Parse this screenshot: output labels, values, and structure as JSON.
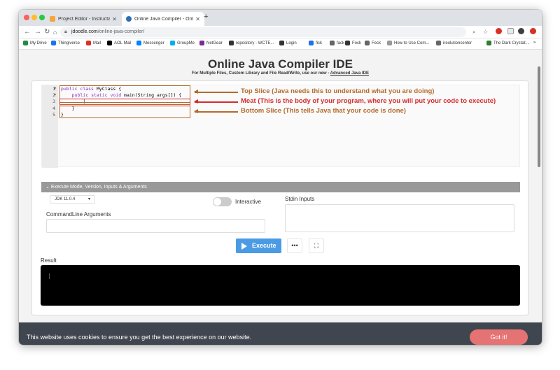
{
  "browser": {
    "tabs": [
      {
        "title": "Project Editor - Instructables"
      },
      {
        "title": "Online Java Compiler - Online"
      }
    ],
    "url_host": "jdoodle.com",
    "url_path": "/online-java-compiler/",
    "bookmarks": [
      {
        "label": "My Drive",
        "color": "#1e8e3e"
      },
      {
        "label": "Thingiverse",
        "color": "#1a73e8"
      },
      {
        "label": "Mail",
        "color": "#d93025"
      },
      {
        "label": "AOL Mail",
        "color": "#000000"
      },
      {
        "label": "Messenger",
        "color": "#0084ff"
      },
      {
        "label": "GroupMe",
        "color": "#00aff0"
      },
      {
        "label": "NetGear",
        "color": "#7b2c8f"
      },
      {
        "label": "repository - WCTE...",
        "color": "#333333"
      },
      {
        "label": "Login",
        "color": "#333333"
      },
      {
        "label": "fick",
        "color": "#1a73e8"
      },
      {
        "label": "fack",
        "color": "#666666"
      },
      {
        "label": "Fock",
        "color": "#333333"
      },
      {
        "label": "Feck",
        "color": "#666666"
      },
      {
        "label": "How to Use Com...",
        "color": "#999999"
      },
      {
        "label": "ireolutioncenter",
        "color": "#666666"
      },
      {
        "label": "The Dark Crystal:...",
        "color": "#2e7d32"
      }
    ]
  },
  "page": {
    "title": "Online Java Compiler IDE",
    "subtitle_prefix": "For Multiple Files, Custom Library and File Read/Write, use our new - ",
    "subtitle_link": "Advanced Java IDE"
  },
  "editor": {
    "lines": [
      {
        "num": "1",
        "fold": "▾",
        "code": "public class MyClass {"
      },
      {
        "num": "2",
        "fold": "▾",
        "code": "    public static void main(String args[]) {"
      },
      {
        "num": "3",
        "fold": "",
        "code": "        |"
      },
      {
        "num": "4",
        "fold": "",
        "code": "    }"
      },
      {
        "num": "5",
        "fold": "",
        "code": "}"
      }
    ]
  },
  "annotations": {
    "top": {
      "text": "Top Slice (Java needs this to understand what you are doing)",
      "color": "#b36a2c"
    },
    "meat": {
      "text": "Meat (This is the body of your program, where you will put your code to execute)",
      "color": "#d62a2a"
    },
    "bottom": {
      "text": "Bottom Slice (This tells Java that your code is done)",
      "color": "#b36a2c"
    }
  },
  "options": {
    "header": "Execute Mode, Version, Inputs & Arguments",
    "jdk_version": "JDK 11.0.4",
    "interactive_label": "Interactive",
    "stdin_label": "Stdin Inputs",
    "cmdline_label": "CommandLine Arguments"
  },
  "execute": {
    "label": "Execute",
    "more_label": "•••",
    "fullscreen_label": "⛶"
  },
  "result": {
    "label": "Result"
  },
  "cookie": {
    "text": "This website uses cookies to ensure you get the best experience on our website.",
    "button": "Got it!"
  }
}
